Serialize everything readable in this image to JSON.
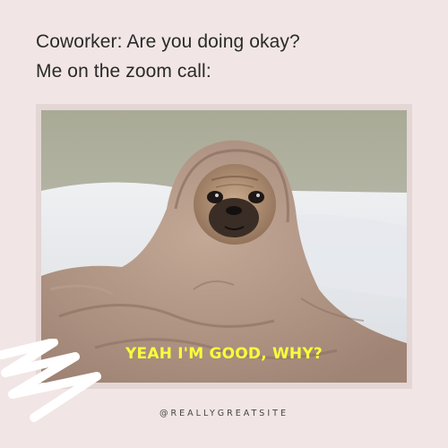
{
  "caption": {
    "line1": "Coworker: Are you doing okay?",
    "line2": "Me on the zoom call:"
  },
  "photo": {
    "overlay_text": "YEAH I'M GOOD, WHY?",
    "overlay_color": "#f5ff3a"
  },
  "footer": {
    "handle": "@REALLYGREATSITE"
  },
  "colors": {
    "background": "#f1e6e5",
    "frame": "#e3d6d4",
    "squiggle": "#ffffff"
  },
  "icons": [
    "squiggle-decoration"
  ]
}
